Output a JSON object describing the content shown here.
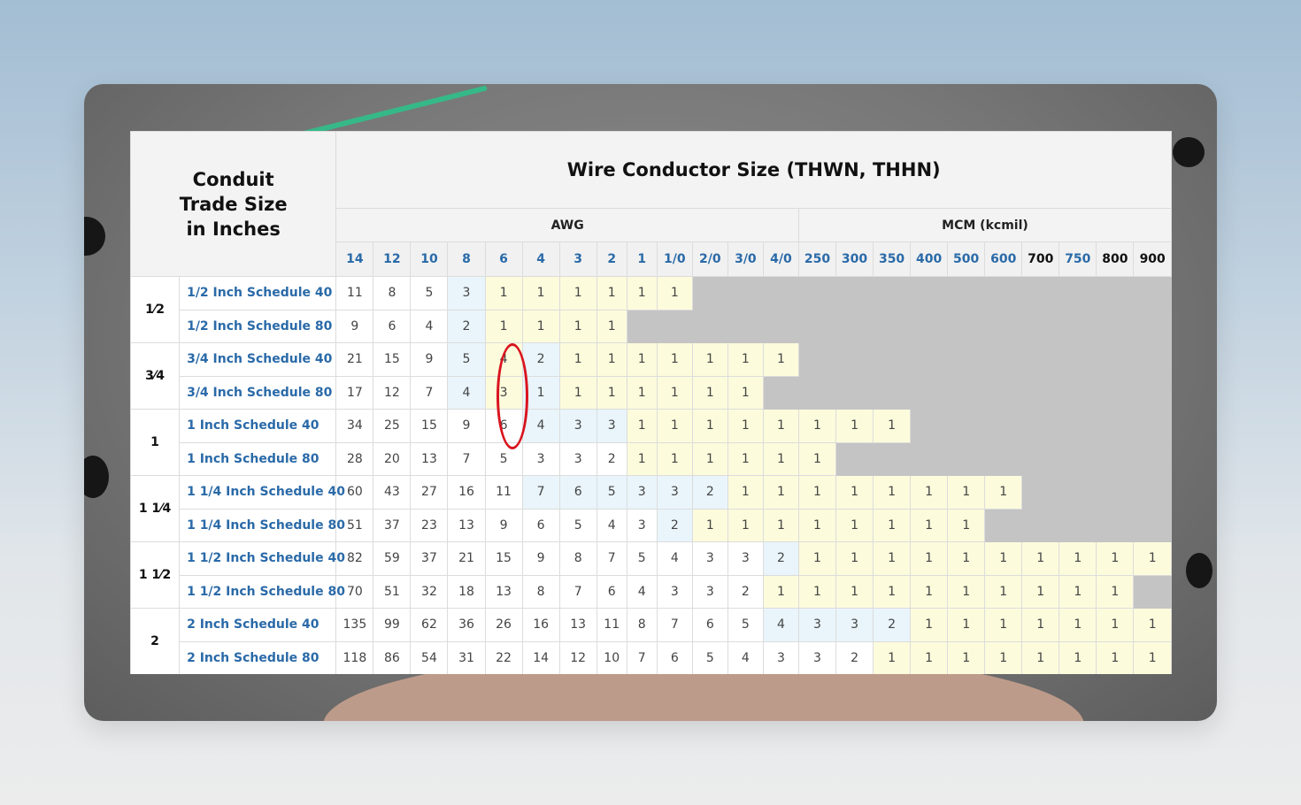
{
  "table": {
    "title": "Wire Conductor Size (THWN, THHN)",
    "corner_label": [
      "Conduit",
      "Trade Size",
      "in Inches"
    ],
    "groups": [
      "AWG",
      "MCM (kcmil)"
    ],
    "columns": [
      "14",
      "12",
      "10",
      "8",
      "6",
      "4",
      "3",
      "2",
      "1",
      "1/0",
      "2/0",
      "3/0",
      "4/0",
      "250",
      "300",
      "350",
      "400",
      "500",
      "600",
      "700",
      "750",
      "800",
      "900"
    ],
    "trade_sizes": [
      "1⁄2",
      "3⁄4",
      "1",
      "1 1⁄4",
      "1 1⁄2",
      "2"
    ],
    "rows": [
      {
        "name": "1/2 Inch Schedule 40",
        "values": [
          "11",
          "8",
          "5",
          "3",
          "1",
          "1",
          "1",
          "1",
          "1",
          "1"
        ]
      },
      {
        "name": "1/2 Inch Schedule 80",
        "values": [
          "9",
          "6",
          "4",
          "2",
          "1",
          "1",
          "1",
          "1"
        ]
      },
      {
        "name": "3/4 Inch Schedule 40",
        "values": [
          "21",
          "15",
          "9",
          "5",
          "4",
          "2",
          "1",
          "1",
          "1",
          "1",
          "1",
          "1",
          "1"
        ]
      },
      {
        "name": "3/4 Inch Schedule 80",
        "values": [
          "17",
          "12",
          "7",
          "4",
          "3",
          "1",
          "1",
          "1",
          "1",
          "1",
          "1",
          "1"
        ]
      },
      {
        "name": "1 Inch Schedule 40",
        "values": [
          "34",
          "25",
          "15",
          "9",
          "6",
          "4",
          "3",
          "3",
          "1",
          "1",
          "1",
          "1",
          "1",
          "1",
          "1",
          "1"
        ]
      },
      {
        "name": "1 Inch Schedule 80",
        "values": [
          "28",
          "20",
          "13",
          "7",
          "5",
          "3",
          "3",
          "2",
          "1",
          "1",
          "1",
          "1",
          "1",
          "1"
        ]
      },
      {
        "name": "1 1/4 Inch Schedule 40",
        "values": [
          "60",
          "43",
          "27",
          "16",
          "11",
          "7",
          "6",
          "5",
          "3",
          "3",
          "2",
          "1",
          "1",
          "1",
          "1",
          "1",
          "1",
          "1",
          "1"
        ]
      },
      {
        "name": "1 1/4 Inch Schedule 80",
        "values": [
          "51",
          "37",
          "23",
          "13",
          "9",
          "6",
          "5",
          "4",
          "3",
          "2",
          "1",
          "1",
          "1",
          "1",
          "1",
          "1",
          "1",
          "1"
        ]
      },
      {
        "name": "1 1/2 Inch Schedule 40",
        "values": [
          "82",
          "59",
          "37",
          "21",
          "15",
          "9",
          "8",
          "7",
          "5",
          "4",
          "3",
          "3",
          "2",
          "1",
          "1",
          "1",
          "1",
          "1",
          "1",
          "1",
          "1",
          "1",
          "1"
        ]
      },
      {
        "name": "1 1/2 Inch Schedule 80",
        "values": [
          "70",
          "51",
          "32",
          "18",
          "13",
          "8",
          "7",
          "6",
          "4",
          "3",
          "3",
          "2",
          "1",
          "1",
          "1",
          "1",
          "1",
          "1",
          "1",
          "1",
          "1",
          "1"
        ]
      },
      {
        "name": "2 Inch Schedule 40",
        "values": [
          "135",
          "99",
          "62",
          "36",
          "26",
          "16",
          "13",
          "11",
          "8",
          "7",
          "6",
          "5",
          "4",
          "3",
          "3",
          "2",
          "1",
          "1",
          "1",
          "1",
          "1",
          "1",
          "1"
        ]
      },
      {
        "name": "2 Inch Schedule 80",
        "values": [
          "118",
          "86",
          "54",
          "31",
          "22",
          "14",
          "12",
          "10",
          "7",
          "6",
          "5",
          "4",
          "3",
          "3",
          "2",
          "1",
          "1",
          "1",
          "1",
          "1",
          "1",
          "1",
          "1"
        ]
      }
    ],
    "cell_shading": [
      "wwwbyyyyyy",
      "wwwbyyyy",
      "wwwbybyyyyyyy",
      "wwwbybyyyyyy",
      "wwwwwbbbyyyyyyyy",
      "wwwwwwwwyyyyyy",
      "wwwwwbbbbbbyyyyyyyy",
      "wwwwwwwwwbyyyyyyyy",
      "wwwwwwwwwwwwbyyyyyyyyyy",
      "wwwwwwwwwwwwyyyyyyyyyy",
      "wwwwwwwwwwwwbbbbyyyyyyy",
      "wwwwwwwwwwwwwwwyyyyyyyy"
    ],
    "colors": {
      "awg_header": "#2a6aa8",
      "highlight_ring": "#d9141e",
      "yellow_cell": "#fcfbdc",
      "blue_cell": "#e9f5fb",
      "empty_cell": "#c4c4c4"
    }
  }
}
